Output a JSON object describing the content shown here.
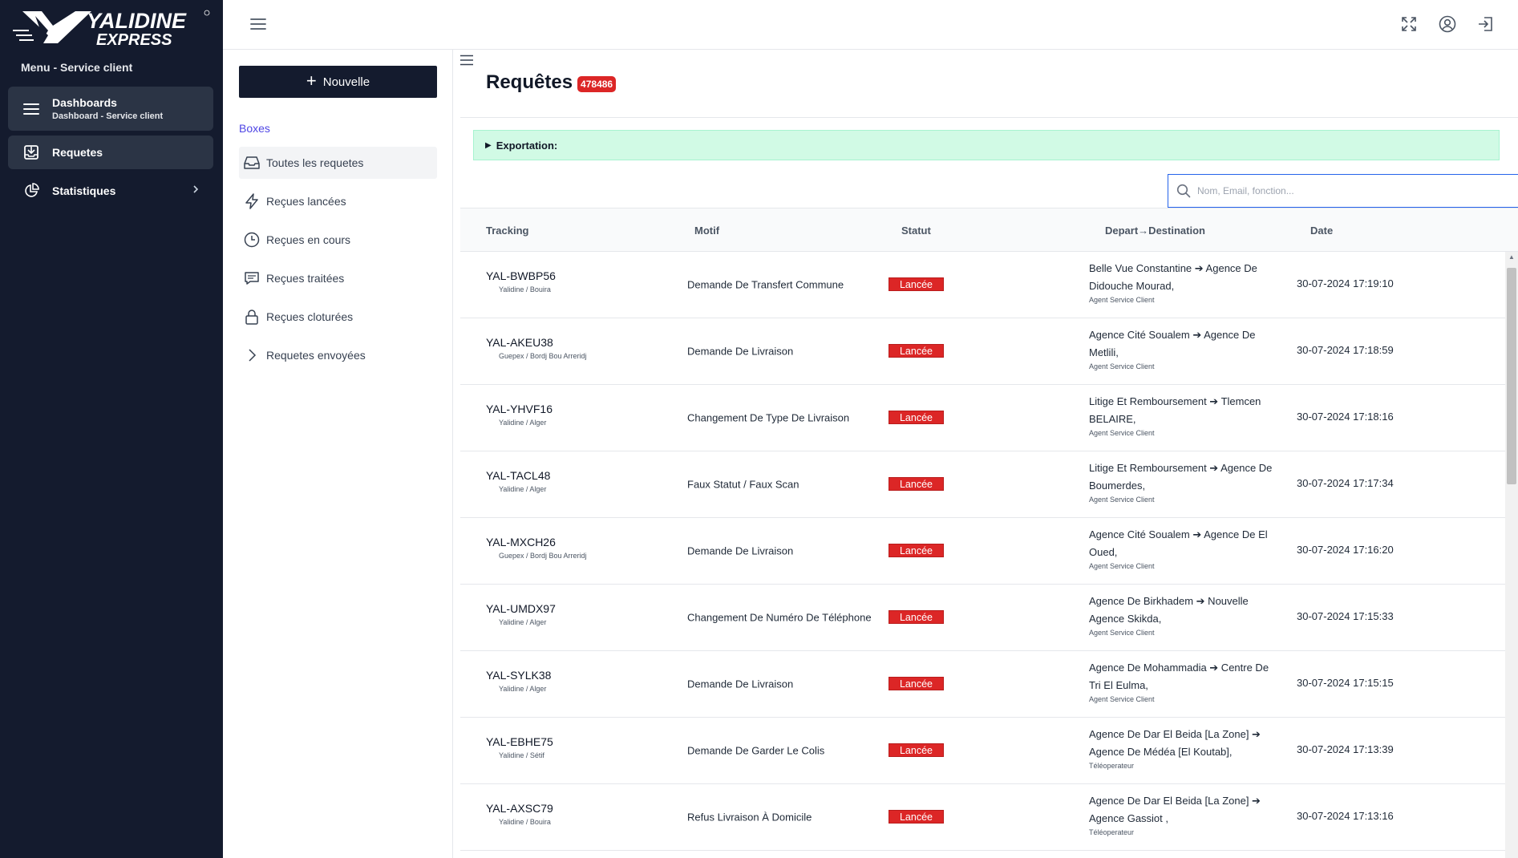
{
  "brand": {
    "name": "YALIDINE",
    "sub": "EXPRESS"
  },
  "sidebar": {
    "menu_title": "Menu - Service client",
    "items": [
      {
        "label": "Dashboards",
        "sub": "Dashboard - Service client",
        "icon": "menu-lines-icon"
      },
      {
        "label": "Requetes",
        "icon": "inbox-download-icon"
      },
      {
        "label": "Statistiques",
        "icon": "pie-chart-icon"
      }
    ]
  },
  "topbar": {
    "icons": [
      "hamburger-icon",
      "fullscreen-icon",
      "user-circle-icon",
      "logout-icon"
    ]
  },
  "boxes": {
    "new_label": "Nouvelle",
    "title": "Boxes",
    "items": [
      {
        "label": "Toutes les requetes",
        "icon": "inbox-icon"
      },
      {
        "label": "Reçues lancées",
        "icon": "lightning-icon"
      },
      {
        "label": "Reçues en cours",
        "icon": "clock-icon"
      },
      {
        "label": "Reçues traitées",
        "icon": "chat-icon"
      },
      {
        "label": "Reçues cloturées",
        "icon": "lock-icon"
      },
      {
        "label": "Requetes envoyées",
        "icon": "chevron-right-icon"
      }
    ]
  },
  "main": {
    "title": "Requêtes",
    "count": "478486",
    "export_label": "Exportation:",
    "search_placeholder": "Nom, Email, fonction...",
    "columns": [
      "Tracking",
      "Motif",
      "Statut",
      "Depart→Destination",
      "Date"
    ],
    "rows": [
      {
        "tracking": "YAL-BWBP56",
        "origin": "Yalidine / Bouira",
        "motif": "Demande De Transfert Commune",
        "status": "Lancée",
        "dest": "Belle Vue Constantine ➔ Agence De Didouche Mourad,",
        "agent": "Agent Service Client",
        "date": "30-07-2024 17:19:10"
      },
      {
        "tracking": "YAL-AKEU38",
        "origin": "Guepex / Bordj Bou Arreridj",
        "motif": "Demande De Livraison",
        "status": "Lancée",
        "dest": "Agence Cité Soualem ➔ Agence De Metlili,",
        "agent": "Agent Service Client",
        "date": "30-07-2024 17:18:59"
      },
      {
        "tracking": "YAL-YHVF16",
        "origin": "Yalidine / Alger",
        "motif": "Changement De Type De Livraison",
        "status": "Lancée",
        "dest": "Litige Et Remboursement ➔ Tlemcen BELAIRE,",
        "agent": "Agent Service Client",
        "date": "30-07-2024 17:18:16"
      },
      {
        "tracking": "YAL-TACL48",
        "origin": "Yalidine / Alger",
        "motif": "Faux Statut / Faux Scan",
        "status": "Lancée",
        "dest": "Litige Et Remboursement ➔ Agence De Boumerdes,",
        "agent": "Agent Service Client",
        "date": "30-07-2024 17:17:34"
      },
      {
        "tracking": "YAL-MXCH26",
        "origin": "Guepex / Bordj Bou Arreridj",
        "motif": "Demande De Livraison",
        "status": "Lancée",
        "dest": "Agence Cité Soualem ➔ Agence De El Oued,",
        "agent": "Agent Service Client",
        "date": "30-07-2024 17:16:20"
      },
      {
        "tracking": "YAL-UMDX97",
        "origin": "Yalidine / Alger",
        "motif": "Changement De Numéro De Téléphone",
        "status": "Lancée",
        "dest": "Agence De Birkhadem ➔ Nouvelle Agence Skikda,",
        "agent": "Agent Service Client",
        "date": "30-07-2024 17:15:33"
      },
      {
        "tracking": "YAL-SYLK38",
        "origin": "Yalidine / Alger",
        "motif": "Demande De Livraison",
        "status": "Lancée",
        "dest": "Agence De Mohammadia ➔ Centre De Tri El Eulma,",
        "agent": "Agent Service Client",
        "date": "30-07-2024 17:15:15"
      },
      {
        "tracking": "YAL-EBHE75",
        "origin": "Yalidine / Sétif",
        "motif": "Demande De Garder Le Colis",
        "status": "Lancée",
        "dest": "Agence De Dar El Beida [La Zone] ➔ Agence De Médéa [El Koutab],",
        "agent": "Téléoperateur",
        "date": "30-07-2024 17:13:39"
      },
      {
        "tracking": "YAL-AXSC79",
        "origin": "Yalidine / Bouira",
        "motif": "Refus Livraison À Domicile",
        "status": "Lancée",
        "dest": "Agence De Dar El Beida [La Zone] ➔ Agence Gassiot ,",
        "agent": "Téléoperateur",
        "date": "30-07-2024 17:13:16"
      }
    ]
  }
}
